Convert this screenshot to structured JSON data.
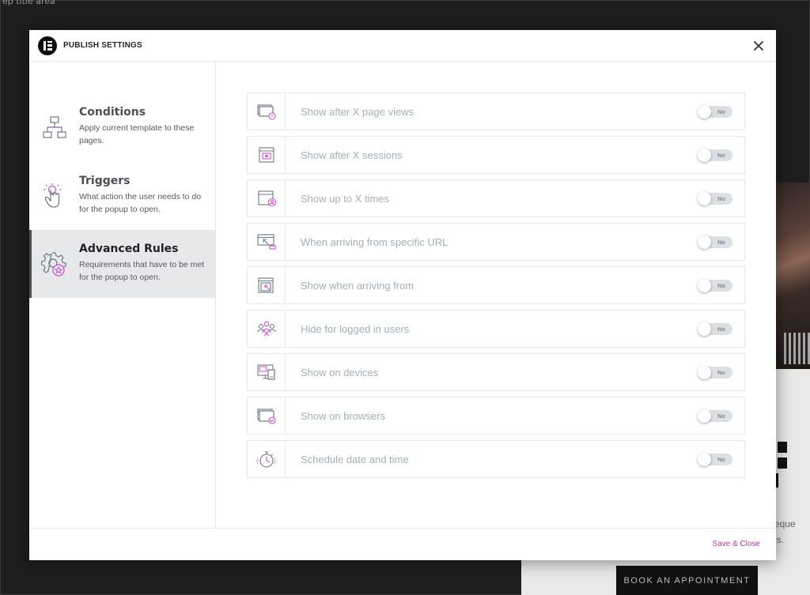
{
  "background": {
    "corner_text": "ep title area",
    "cta_label": "BOOK AN APPOINTMENT",
    "text_line1": "eque",
    "text_line2": "is."
  },
  "modal": {
    "title": "PUBLISH SETTINGS",
    "close_icon": "close-icon",
    "save_label": "Save & Close"
  },
  "sidebar": {
    "items": [
      {
        "title": "Conditions",
        "description": "Apply current template to these pages.",
        "icon": "sitemap-icon",
        "active": false
      },
      {
        "title": "Triggers",
        "description": "What action the user needs to do for the popup to open.",
        "icon": "tap-hand-icon",
        "active": false
      },
      {
        "title": "Advanced Rules",
        "description": "Requirements that have to be met for the popup to open.",
        "icon": "gear-star-icon",
        "active": true
      }
    ]
  },
  "rules": [
    {
      "label": "Show after X page views",
      "icon": "page-views-icon",
      "toggle": "No"
    },
    {
      "label": "Show after X sessions",
      "icon": "sessions-icon",
      "toggle": "No"
    },
    {
      "label": "Show up to X times",
      "icon": "user-window-icon",
      "toggle": "No"
    },
    {
      "label": "When arriving from specific URL",
      "icon": "url-cursor-icon",
      "toggle": "No"
    },
    {
      "label": "Show when arriving from",
      "icon": "arrival-icon",
      "toggle": "No"
    },
    {
      "label": "Hide for logged in users",
      "icon": "users-group-icon",
      "toggle": "No"
    },
    {
      "label": "Show on devices",
      "icon": "devices-icon",
      "toggle": "No"
    },
    {
      "label": "Show on browsers",
      "icon": "browser-check-icon",
      "toggle": "No"
    },
    {
      "label": "Schedule date and time",
      "icon": "stopwatch-icon",
      "toggle": "No"
    }
  ],
  "colors": {
    "accent": "#c036a8",
    "icon_accent": "#d04ed6",
    "muted_text": "#a4afb7",
    "active_bg": "#e6e8ea"
  }
}
